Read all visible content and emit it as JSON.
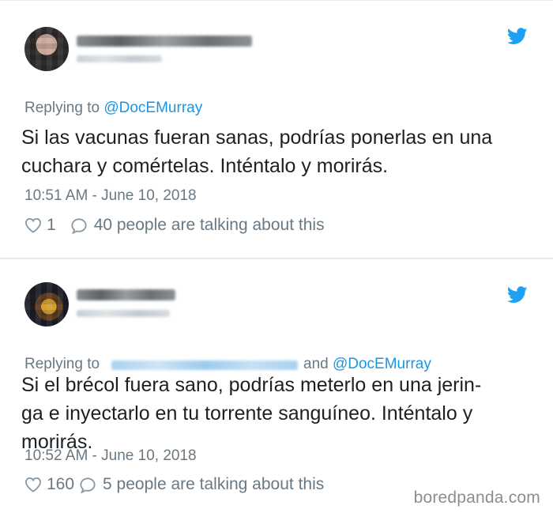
{
  "tweets": [
    {
      "replying_prefix": "Replying to",
      "replying_to": "@DocEMurray",
      "text_line1": "Si las vacunas fueran sanas, podrías ponerlas en una",
      "text_line2": "cuchara y comértelas. Inténtalo y morirás.",
      "timestamp": "10:51 AM - June 10, 2018",
      "likes": "1",
      "talking": "40 people are talking about this"
    },
    {
      "replying_prefix": "Replying to",
      "replying_and": "and",
      "replying_to": "@DocEMurray",
      "text_line1": "Si el brécol fuera sano, podrías meterlo en una jerin-",
      "text_line2": "ga e inyectarlo en tu torrente sanguíneo. Inténtalo y",
      "text_line3": "morirás.",
      "timestamp": "10:52 AM - June 10, 2018",
      "likes": "160",
      "talking": "5 people are talking about this"
    }
  ],
  "watermark": "boredpanda.com",
  "colors": {
    "accent": "#1b95e0",
    "muted": "#697882",
    "text": "#1c2022"
  },
  "icons": [
    "twitter-bird-icon",
    "heart-icon",
    "comment-icon"
  ]
}
